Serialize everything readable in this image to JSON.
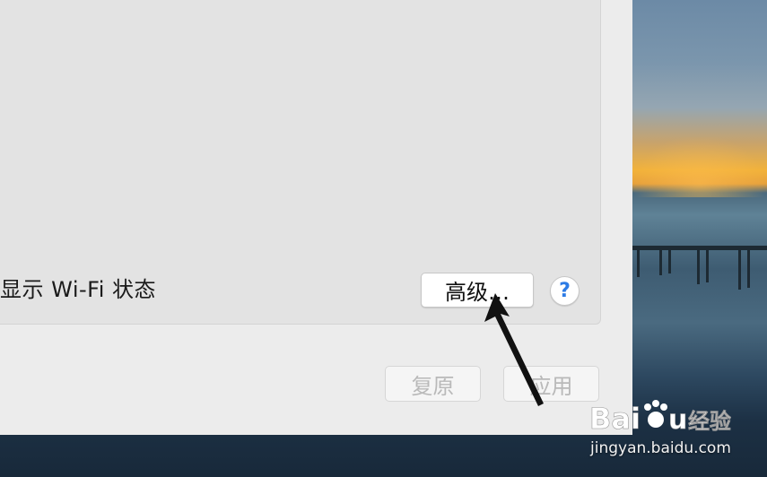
{
  "network": {
    "wifi_status_label": "显示 Wi-Fi 状态",
    "advanced_button": "高级…",
    "help_button": "?",
    "revert_button": "复原",
    "apply_button": "应用"
  },
  "watermark": {
    "brand": "Baidu 经验",
    "domain": "jingyan.baidu.com"
  },
  "colors": {
    "window_bg": "#ececec",
    "panel_bg": "#e3e3e3",
    "help_accent": "#2d7be5",
    "disabled_text": "#b9b9b9"
  }
}
